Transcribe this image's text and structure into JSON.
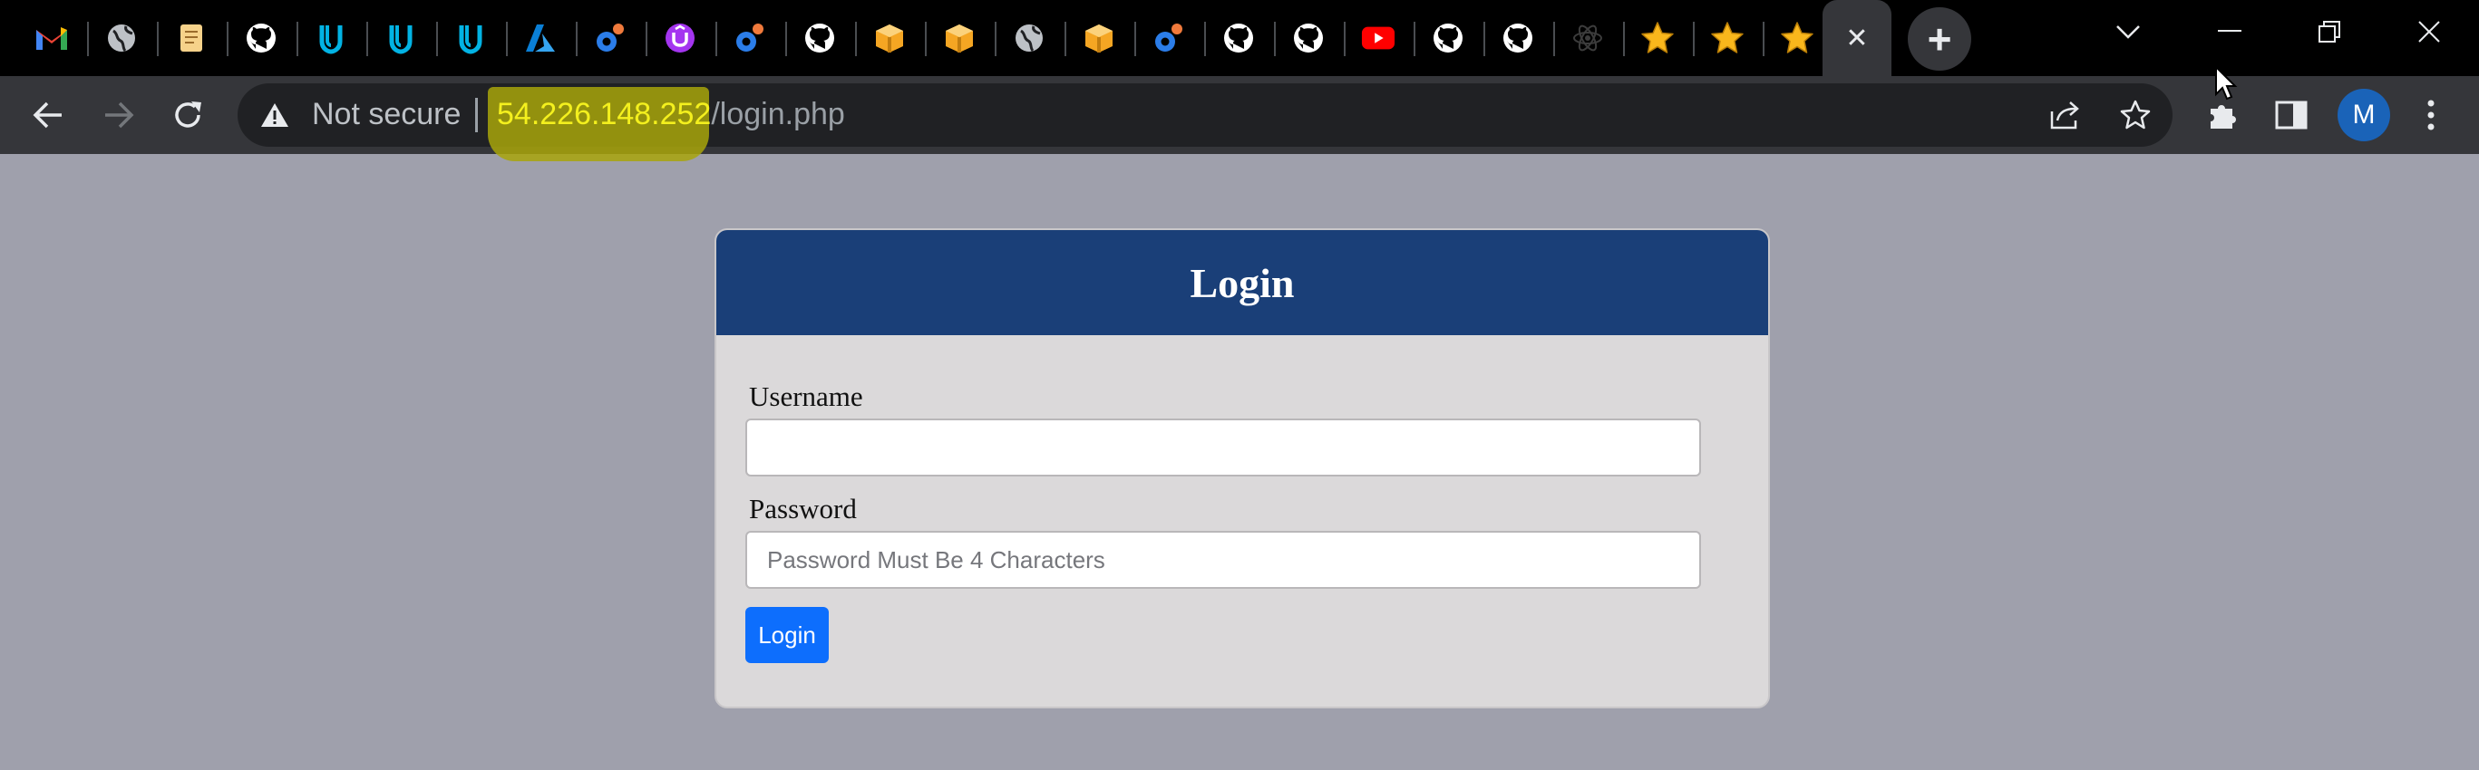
{
  "browser": {
    "tabs": [
      {
        "icon": "gmail-icon"
      },
      {
        "icon": "globe-icon"
      },
      {
        "icon": "notes-icon"
      },
      {
        "icon": "github-icon"
      },
      {
        "icon": "udacity-icon"
      },
      {
        "icon": "udacity-icon"
      },
      {
        "icon": "udacity-icon"
      },
      {
        "icon": "azure-icon"
      },
      {
        "icon": "grammarly-icon"
      },
      {
        "icon": "u-circle-icon"
      },
      {
        "icon": "grammarly-icon"
      },
      {
        "icon": "github-icon"
      },
      {
        "icon": "box-icon"
      },
      {
        "icon": "box-icon"
      },
      {
        "icon": "globe-icon"
      },
      {
        "icon": "box-icon"
      },
      {
        "icon": "grammarly-icon"
      },
      {
        "icon": "github-icon"
      },
      {
        "icon": "github-icon"
      },
      {
        "icon": "youtube-icon"
      },
      {
        "icon": "github-icon"
      },
      {
        "icon": "github-icon"
      },
      {
        "icon": "react-icon"
      },
      {
        "icon": "star-icon"
      },
      {
        "icon": "star-icon"
      },
      {
        "icon": "star-icon"
      }
    ],
    "active_tab_close": "✕",
    "new_tab": "+",
    "avatar_letter": "M",
    "omnibox": {
      "security_label": "Not secure",
      "url_host": "54.226.148.252",
      "url_path": "/login.php"
    },
    "colors": {
      "tabstrip_bg": "#000000",
      "toolbar_bg": "#35363a",
      "url_highlight": "#a8a40a",
      "url_host_color": "#f4f01e"
    }
  },
  "page": {
    "background": "#9fa0ac",
    "login_card": {
      "title": "Login",
      "username_label": "Username",
      "username_value": "",
      "password_label": "Password",
      "password_placeholder": "Password Must Be 4 Characters",
      "submit_label": "Login",
      "header_color": "#1a3f78",
      "button_color": "#0d6efd"
    }
  }
}
